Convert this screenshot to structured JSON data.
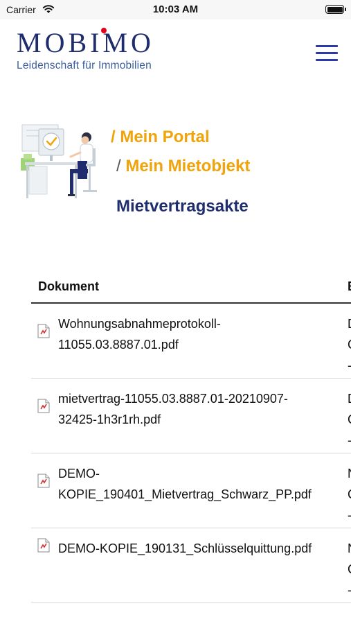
{
  "status_bar": {
    "carrier": "Carrier",
    "time": "10:03 AM"
  },
  "header": {
    "logo_text": "MOBIMO",
    "tagline": "Leidenschaft für Immobilien",
    "logo_color": "#1f2d6e",
    "logo_dot_color": "#e2001a",
    "menu_icon": "hamburger-menu-icon"
  },
  "breadcrumb": {
    "items": [
      "/ Mein Portal",
      "/ Mein Mietobjekt"
    ],
    "color": "#f0a30a"
  },
  "page_title": "Mietvertragsakte",
  "table": {
    "columns": [
      "Dokument",
      "B"
    ],
    "rows": [
      {
        "file_line1": "Wohnungsabnahmeprotokoll-",
        "file_line2": "11055.03.8887.01.pdf",
        "col2_lines": [
          "D",
          "C",
          "-"
        ]
      },
      {
        "file_line1": "mietvertrag-11055.03.8887.01-20210907-",
        "file_line2": "32425-1h3r1rh.pdf",
        "col2_lines": [
          "D",
          "C",
          "-"
        ]
      },
      {
        "file_line1": "DEMO-",
        "file_line2": "KOPIE_190401_Mietvertrag_Schwarz_PP.pdf",
        "col2_lines": [
          "N",
          "C",
          "-"
        ]
      },
      {
        "file_line1": "DEMO-KOPIE_190131_Schlüsselquittung.pdf",
        "file_line2": "",
        "col2_lines": [
          "N",
          "C",
          "-"
        ]
      }
    ]
  }
}
